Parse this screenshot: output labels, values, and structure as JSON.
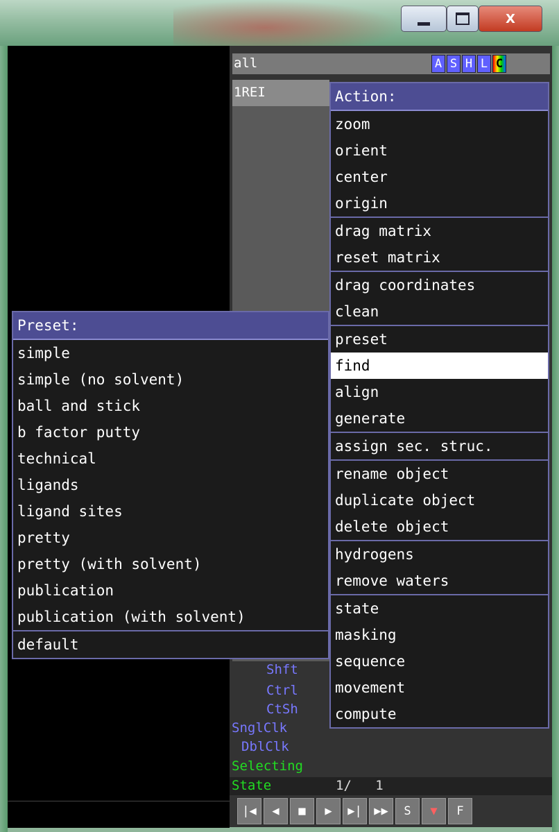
{
  "window": {
    "min_icon": "minimize-icon",
    "max_icon": "maximize-icon",
    "close_label": "X"
  },
  "object_panel": {
    "all_label": "all",
    "buttons": [
      {
        "label": "A",
        "color": "#6060ff"
      },
      {
        "label": "S",
        "color": "#6060ff"
      },
      {
        "label": "H",
        "color": "#6060ff"
      },
      {
        "label": "L",
        "color": "#6060ff"
      },
      {
        "label": "C",
        "color": "#ffee00"
      }
    ],
    "object_name": "1REI"
  },
  "mouse_panel": {
    "shft": "Shft",
    "ctrl": "Ctrl",
    "ctsh": "CtSh",
    "sngl": "SnglClk",
    "dbl": "DblClk",
    "selecting": "Selecting",
    "state_label": "State",
    "state_value": "1/   1"
  },
  "transport": [
    "|◀",
    "◀",
    "■",
    "▶",
    "▶|",
    "▶▶",
    "S",
    "▼",
    "F"
  ],
  "action_menu": {
    "title": "Action:",
    "groups": [
      [
        "zoom",
        "orient",
        "center",
        "origin"
      ],
      [
        "drag matrix",
        "reset matrix"
      ],
      [
        "drag coordinates",
        "clean"
      ],
      [
        "preset",
        "find",
        "align",
        "generate"
      ],
      [
        "assign sec. struc."
      ],
      [
        "rename object",
        "duplicate object",
        "delete object"
      ],
      [
        "hydrogens",
        "remove waters"
      ],
      [
        "state",
        "masking",
        "sequence",
        "movement",
        "compute"
      ]
    ],
    "selected": "find"
  },
  "preset_menu": {
    "title": "Preset:",
    "groups": [
      [
        "simple",
        "simple (no solvent)",
        "ball and stick",
        "b factor putty",
        "technical",
        "ligands",
        "ligand sites",
        "pretty",
        "pretty (with solvent)",
        "publication",
        "publication (with solvent)"
      ],
      [
        "default"
      ]
    ]
  }
}
